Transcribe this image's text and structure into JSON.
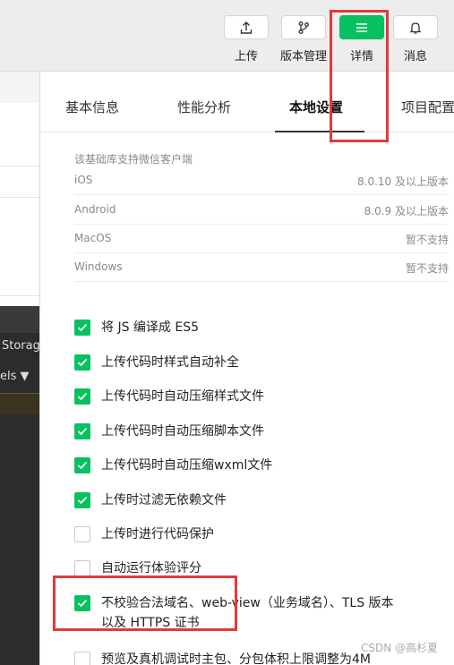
{
  "toolbar": {
    "buttons": [
      {
        "label": "上传",
        "icon": "upload-icon"
      },
      {
        "label": "版本管理",
        "icon": "branch-icon"
      },
      {
        "label": "详情",
        "icon": "menu-icon"
      },
      {
        "label": "消息",
        "icon": "bell-icon"
      }
    ],
    "active_color": "#07c160"
  },
  "left_pane": {
    "storage_label": "Storag",
    "els_label": "els ▼"
  },
  "tabs": [
    "基本信息",
    "性能分析",
    "本地设置",
    "项目配置"
  ],
  "active_tab": "本地设置",
  "library_support": {
    "title": "该基础库支持微信客户端",
    "rows": [
      {
        "platform": "iOS",
        "value": "8.0.10 及以上版本"
      },
      {
        "platform": "Android",
        "value": "8.0.9 及以上版本"
      },
      {
        "platform": "MacOS",
        "value": "暂不支持"
      },
      {
        "platform": "Windows",
        "value": "暂不支持"
      }
    ]
  },
  "options": [
    {
      "label": "将 JS 编译成 ES5",
      "checked": true
    },
    {
      "label": "上传代码时样式自动补全",
      "checked": true
    },
    {
      "label": "上传代码时自动压缩样式文件",
      "checked": true
    },
    {
      "label": "上传代码时自动压缩脚本文件",
      "checked": true
    },
    {
      "label": "上传代码时自动压缩wxml文件",
      "checked": true
    },
    {
      "label": "上传时过滤无依赖文件",
      "checked": true
    },
    {
      "label": "上传时进行代码保护",
      "checked": false
    },
    {
      "label": "自动运行体验评分",
      "checked": false
    },
    {
      "label": "不校验合法域名、web-view（业务域名）、TLS 版本以及 HTTPS 证书",
      "checked": true
    },
    {
      "label": "预览及真机调试时主包、分包体积上限调整为4M",
      "checked": false
    }
  ],
  "watermark": "CSDN @高杉夏",
  "highlight_color": "#e23a3a"
}
